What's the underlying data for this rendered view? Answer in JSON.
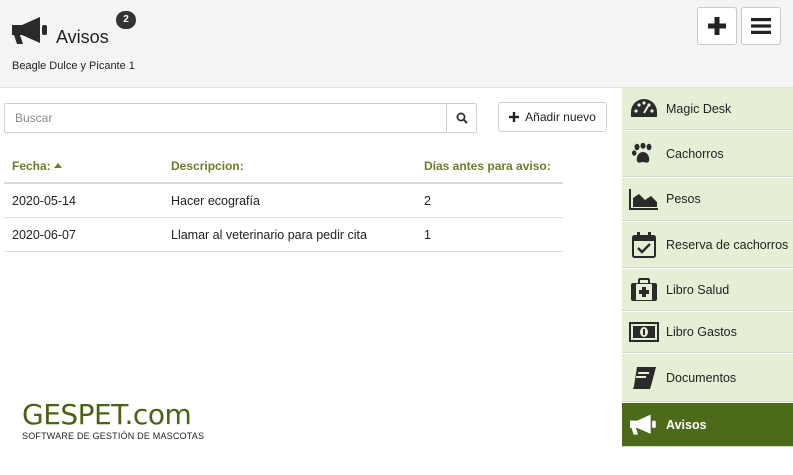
{
  "header": {
    "title": "Avisos",
    "badge_count": "2",
    "subtitle": "Beagle Dulce y Picante 1",
    "add_icon": "plus-icon",
    "menu_icon": "hamburger-icon"
  },
  "search": {
    "placeholder": "Buscar",
    "value": "",
    "icon": "search-icon"
  },
  "add_new": {
    "label": "Añadir nuevo",
    "icon": "plus-icon"
  },
  "table": {
    "columns": [
      "Fecha:",
      "Descripcion:",
      "Días antes para aviso:"
    ],
    "sorted_column": "Fecha:",
    "rows": [
      {
        "fecha": "2020-05-14",
        "descripcion": "Hacer ecografía",
        "dias": "2"
      },
      {
        "fecha": "2020-06-07",
        "descripcion": "Llamar al veterinario para pedir cita",
        "dias": "1"
      }
    ]
  },
  "logo": {
    "brand": "GESPET.com",
    "tagline": "SOFTWARE DE GESTIÓN DE MASCOTAS"
  },
  "sidebar": {
    "items": [
      {
        "label": "Magic Desk",
        "icon": "dashboard-icon",
        "active": false
      },
      {
        "label": "Cachorros",
        "icon": "paw-icon",
        "active": false
      },
      {
        "label": "Pesos",
        "icon": "area-chart-icon",
        "active": false
      },
      {
        "label": "Reserva de cachorros",
        "icon": "calendar-check-icon",
        "active": false
      },
      {
        "label": "Libro Salud",
        "icon": "medkit-icon",
        "active": false
      },
      {
        "label": "Libro Gastos",
        "icon": "money-icon",
        "active": false
      },
      {
        "label": "Documentos",
        "icon": "book-icon",
        "active": false
      },
      {
        "label": "Avisos",
        "icon": "megaphone-icon",
        "active": true
      }
    ]
  },
  "colors": {
    "accent_green": "#6b7f2a",
    "sidebar_bg": "#e4efd6",
    "sidebar_active": "#4c6a1a",
    "brand_green": "#4b6114"
  }
}
